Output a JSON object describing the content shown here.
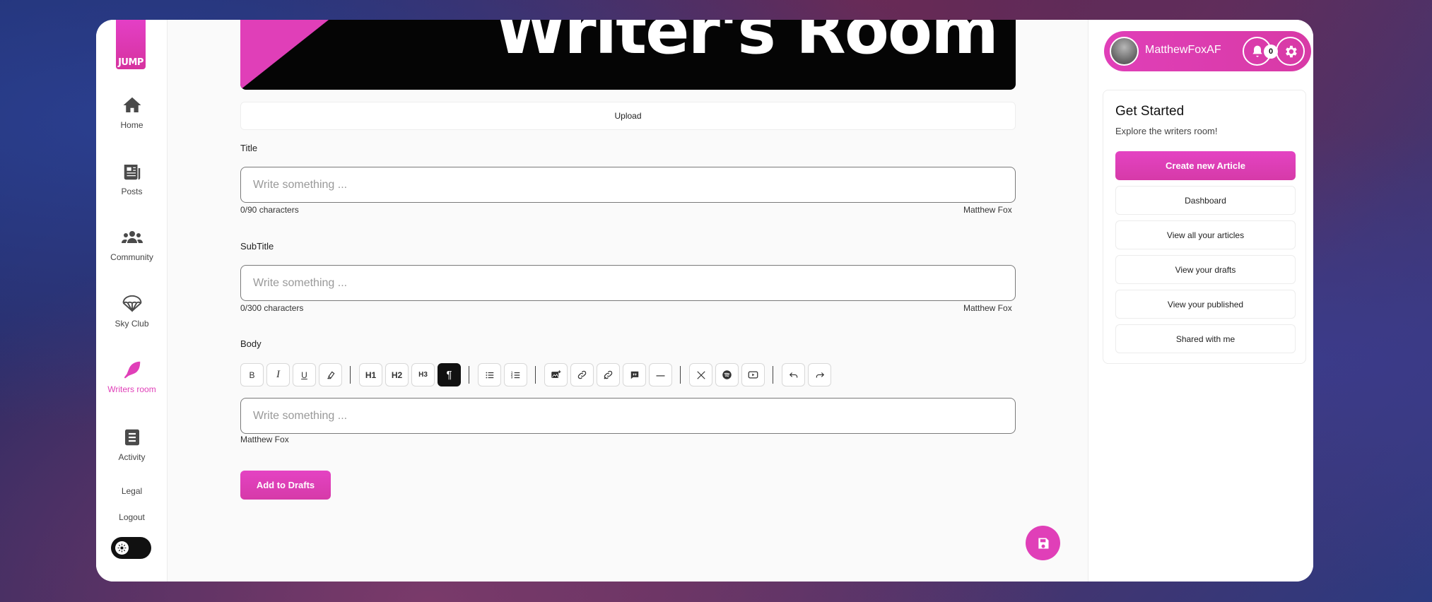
{
  "brand": {
    "logo_text": "JUMP",
    "accent": "#e03fb8"
  },
  "leftnav": {
    "items": [
      {
        "label": "Home",
        "icon": "home-icon"
      },
      {
        "label": "Posts",
        "icon": "newspaper-icon"
      },
      {
        "label": "Community",
        "icon": "users-icon"
      },
      {
        "label": "Sky Club",
        "icon": "parachute-icon"
      },
      {
        "label": "Writers room",
        "icon": "feather-icon",
        "active": true
      },
      {
        "label": "Activity",
        "icon": "list-icon"
      }
    ],
    "legal": "Legal",
    "logout": "Logout",
    "theme_toggle_icon": "sun-icon"
  },
  "main": {
    "banner_title": "Writer's Room",
    "upload_label": "Upload",
    "title": {
      "label": "Title",
      "placeholder": "Write something ...",
      "counter": "0/90 characters",
      "author": "Matthew Fox"
    },
    "subtitle": {
      "label": "SubTitle",
      "placeholder": "Write something ...",
      "counter": "0/300 characters",
      "author": "Matthew Fox"
    },
    "body": {
      "label": "Body",
      "placeholder": "Write something ...",
      "author": "Matthew Fox",
      "toolbar": {
        "bold": "B",
        "italic": "I",
        "underline": "U",
        "h1": "H1",
        "h2": "H2",
        "h3": "H3",
        "paragraph": "¶",
        "horizontal_rule": "—"
      }
    },
    "add_to_drafts": "Add to Drafts",
    "save_icon": "save-icon"
  },
  "rightpanel": {
    "username": "MatthewFoxAF",
    "notifications_count": "0",
    "card": {
      "title": "Get Started",
      "subtitle": "Explore the writers room!",
      "primary": "Create new Article",
      "links": [
        "Dashboard",
        "View all your articles",
        "View your drafts",
        "View your published",
        "Shared with me"
      ]
    }
  }
}
